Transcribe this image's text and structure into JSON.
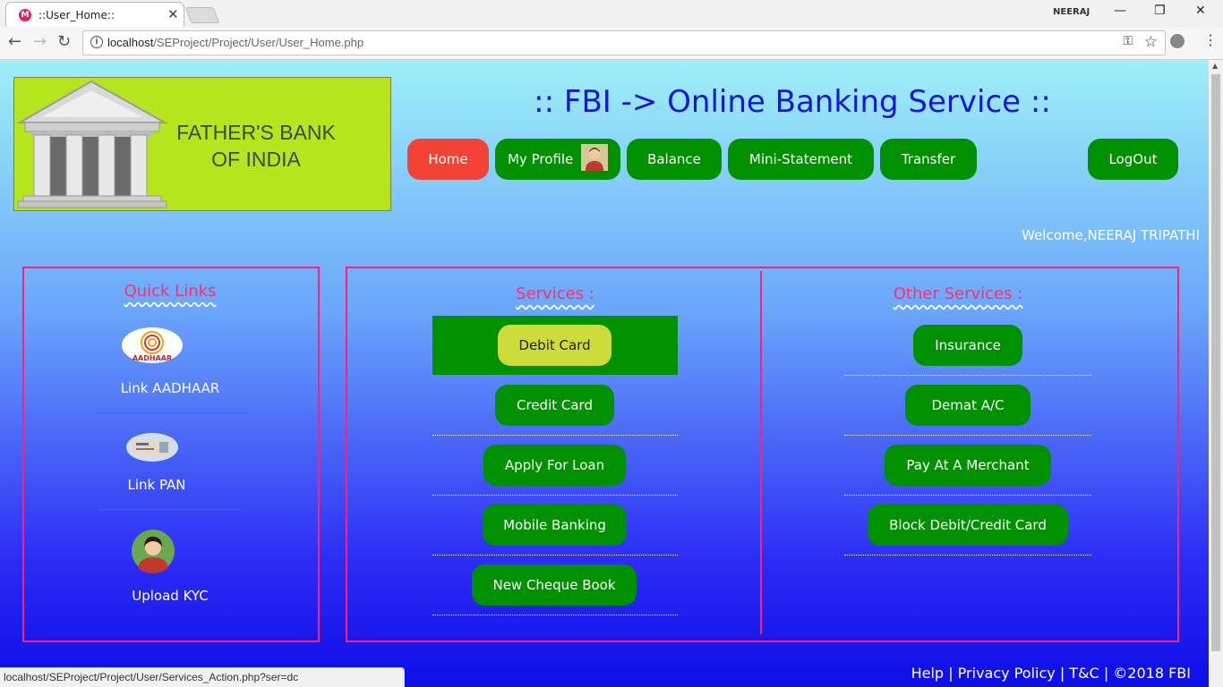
{
  "browser": {
    "tab_title": "::User_Home::",
    "profile_name": "NEERAJ",
    "url_host": "localhost",
    "url_path": "/SEProject/Project/User/User_Home.php"
  },
  "logo": {
    "line1": "FATHER'S BANK",
    "line2": "OF INDIA"
  },
  "site_title": ":: FBI -> Online Banking Service ::",
  "nav": {
    "home": "Home",
    "profile": "My Profile",
    "balance": "Balance",
    "ministatement": "Mini-Statement",
    "transfer": "Transfer",
    "logout": "LogOut"
  },
  "welcome": "Welcome,NEERAJ TRIPATHI",
  "quick_links": {
    "title": "Quick Links",
    "aadhaar": "Link AADHAAR",
    "aadhaar_logo_text": "AADHAAR",
    "pan": "Link PAN",
    "kyc": "Upload KYC"
  },
  "services": {
    "title": "Services :",
    "debit": "Debit Card",
    "credit": "Credit Card",
    "loan": "Apply For Loan",
    "mobile": "Mobile Banking",
    "cheque": "New Cheque Book"
  },
  "other_services": {
    "title": "Other Services :",
    "insurance": "Insurance",
    "demat": "Demat A/C",
    "merchant": "Pay At A Merchant",
    "block": "Block Debit/Credit Card"
  },
  "footer": {
    "help": "Help",
    "privacy": "Privacy Policy",
    "tc": "T&C",
    "copyright": "©2018 FBI",
    "separator": "|"
  },
  "status_url": "localhost/SEProject/Project/User/Services_Action.php?ser=dc",
  "colors": {
    "nav_green": "#009100",
    "home_red": "#f44336",
    "panel_border": "#ff1e7a",
    "active_button": "#cddc39",
    "title_blue": "#1616d8"
  }
}
